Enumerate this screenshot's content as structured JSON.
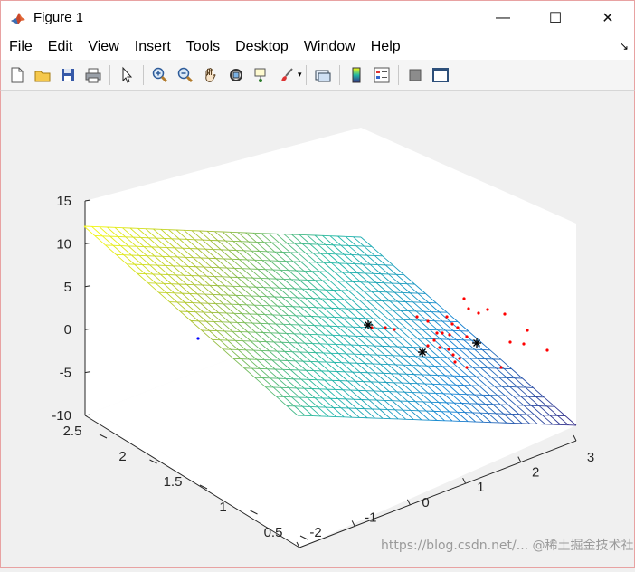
{
  "window": {
    "title": "Figure 1",
    "controls": {
      "minimize": "—",
      "maximize": "☐",
      "close": "✕"
    }
  },
  "menu": {
    "items": [
      "File",
      "Edit",
      "View",
      "Insert",
      "Tools",
      "Desktop",
      "Window",
      "Help"
    ]
  },
  "toolbar": {
    "buttons": [
      {
        "icon": "new-figure-icon"
      },
      {
        "icon": "open-file-icon"
      },
      {
        "icon": "save-icon"
      },
      {
        "icon": "print-icon"
      },
      {
        "icon": "edit-plot-arrow-icon"
      },
      {
        "icon": "zoom-in-icon"
      },
      {
        "icon": "zoom-out-icon"
      },
      {
        "icon": "pan-hand-icon"
      },
      {
        "icon": "rotate-3d-icon"
      },
      {
        "icon": "data-cursor-icon"
      },
      {
        "icon": "brush-icon"
      },
      {
        "icon": "link-plot-icon"
      },
      {
        "icon": "insert-colorbar-icon"
      },
      {
        "icon": "insert-legend-icon"
      },
      {
        "icon": "hide-plot-tools-icon"
      },
      {
        "icon": "show-plot-tools-icon"
      }
    ]
  },
  "chart_data": {
    "type": "scatter",
    "plot3d": true,
    "surface": {
      "kind": "mesh-plane",
      "colormap": "parula",
      "z_at_corner_x_min_y_max": 12,
      "z_range": [
        -10,
        12
      ]
    },
    "axes": {
      "x": {
        "range": [
          -2,
          3
        ],
        "ticks": [
          "-2",
          "-1",
          "0",
          "1",
          "2",
          "3"
        ]
      },
      "y": {
        "range": [
          0.5,
          2.5
        ],
        "ticks": [
          "0.5",
          "1",
          "1.5",
          "2",
          "2.5"
        ]
      },
      "z": {
        "range": [
          -10,
          15
        ],
        "ticks": [
          "-10",
          "-5",
          "0",
          "5",
          "10",
          "15"
        ]
      }
    },
    "series": [
      {
        "marker": "star",
        "color": "#000000",
        "count": 3
      },
      {
        "marker": "dot",
        "color": "#ff0000",
        "count": 30
      },
      {
        "marker": "dot",
        "color": "#0000ff",
        "count": 1
      }
    ]
  },
  "watermark": {
    "text": "https://blog.csdn.net/...  @稀土掘金技术社区"
  }
}
